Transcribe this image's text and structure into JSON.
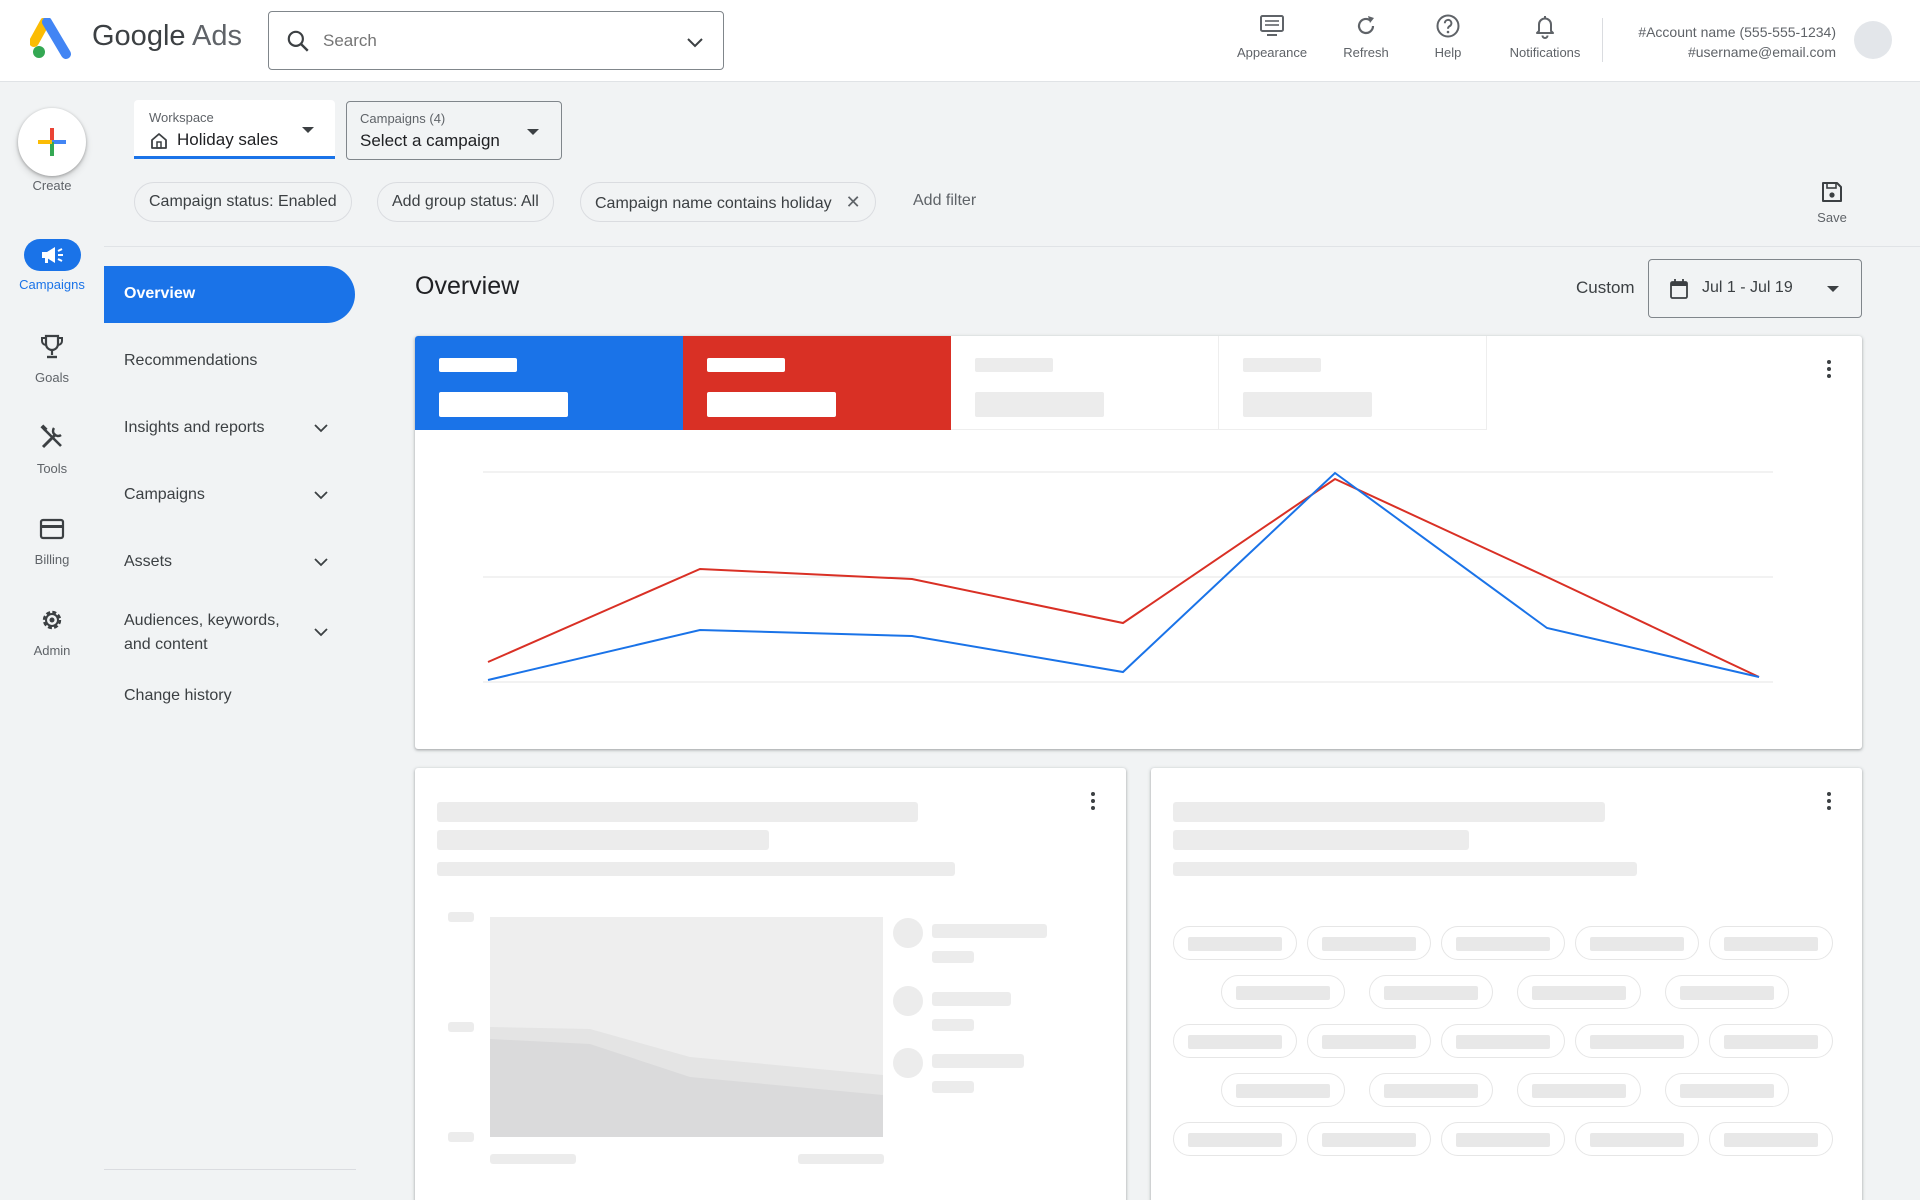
{
  "header": {
    "brand_google": "Google",
    "brand_ads": "Ads",
    "search_placeholder": "Search",
    "actions": [
      {
        "label": "Appearance",
        "icon": "appearance-icon"
      },
      {
        "label": "Refresh",
        "icon": "refresh-icon"
      },
      {
        "label": "Help",
        "icon": "help-icon"
      },
      {
        "label": "Notifications",
        "icon": "bell-icon"
      }
    ],
    "account_name": "#Account name (555-555-1234)",
    "account_email": "#username@email.com"
  },
  "rail": {
    "create_label": "Create",
    "items": [
      {
        "label": "Campaigns",
        "icon": "campaigns-megaphone-icon",
        "active": true
      },
      {
        "label": "Goals",
        "icon": "trophy-icon"
      },
      {
        "label": "Tools",
        "icon": "tools-icon"
      },
      {
        "label": "Billing",
        "icon": "credit-card-icon"
      },
      {
        "label": "Admin",
        "icon": "gear-icon"
      }
    ]
  },
  "filters": {
    "workspace_title": "Workspace",
    "workspace_value": "Holiday sales",
    "campaigns_title": "Campaigns (4)",
    "campaigns_value": "Select a campaign",
    "chips": [
      "Campaign status: Enabled",
      "Add group status: All",
      "Campaign name contains holiday"
    ],
    "add_filter": "Add filter",
    "save_label": "Save"
  },
  "nav": {
    "items": [
      {
        "label": "Overview",
        "active": true
      },
      {
        "label": "Recommendations"
      },
      {
        "label": "Insights and reports",
        "expandable": true
      },
      {
        "label": "Campaigns",
        "expandable": true
      },
      {
        "label": "Assets",
        "expandable": true
      },
      {
        "label": "Audiences, keywords,",
        "label2": "and content",
        "expandable": true
      },
      {
        "label": "Change history"
      }
    ]
  },
  "main": {
    "title": "Overview",
    "range_type": "Custom",
    "date_range": "Jul 1 - Jul 19"
  },
  "colors": {
    "blue": "#1a73e8",
    "red": "#d93025"
  }
}
